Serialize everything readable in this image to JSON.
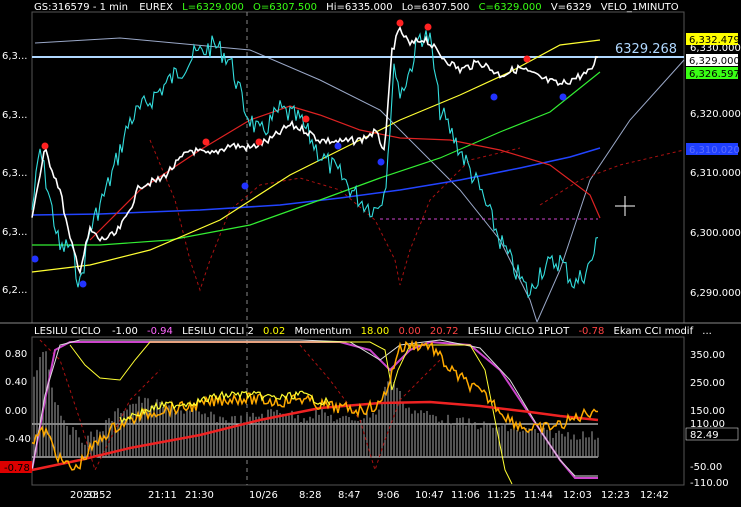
{
  "header": {
    "symbol": "GS:316579 - 1 min",
    "exchange": "EUREX",
    "last": "L=6329.000",
    "open": "O=6307.500",
    "high": "Hi=6335.000",
    "low": "Lo=6307.500",
    "close": "C=6329.000",
    "volume": "V=6329",
    "study": "VELO_1MINUTO"
  },
  "main_panel": {
    "left_axis_labels": [
      "6,3...",
      "6,3...",
      "6,3...",
      "6,3...",
      "6,2..."
    ],
    "right_axis_labels": [
      "6,330.000",
      "6,320.000",
      "6,310.000",
      "6,300.000",
      "6,290.000"
    ],
    "price_tags": [
      {
        "text": "6,332.479",
        "color": "#ffff00"
      },
      {
        "text": "6,329.000",
        "color": "#ffffff"
      },
      {
        "text": "6,326.597",
        "color": "#39ff14"
      },
      {
        "text": "6,310.020",
        "color": "#1f3fff"
      }
    ],
    "hline_label": "6329.268"
  },
  "sub_panel": {
    "legend": [
      {
        "text": "LESILU CICLO",
        "color": "#ffffff"
      },
      {
        "text": "-1.00",
        "color": "#ffffff"
      },
      {
        "text": "-0.94",
        "color": "#ff66ff"
      },
      {
        "text": "LESILU CICLI 2",
        "color": "#ffffff"
      },
      {
        "text": "0.02",
        "color": "#ffff00"
      },
      {
        "text": "Momentum",
        "color": "#ffffff"
      },
      {
        "text": "18.00",
        "color": "#ffff00"
      },
      {
        "text": "0.00",
        "color": "#ff4444"
      },
      {
        "text": "20.72",
        "color": "#ff4444"
      },
      {
        "text": "LESILU CICLO 1PLOT",
        "color": "#ffffff"
      },
      {
        "text": "-0.78",
        "color": "#ff4444"
      },
      {
        "text": "Ekam CCI modif",
        "color": "#ffffff"
      },
      {
        "text": "...",
        "color": "#ffffff"
      }
    ],
    "left_axis_labels": [
      "0.80",
      "0.40",
      "0.00",
      "-0.40",
      "-0.78"
    ],
    "right_axis_labels": [
      "350.00",
      "250.00",
      "150.00",
      "110.00",
      "50.00",
      "-50.00",
      "-110.00"
    ],
    "right_tags": [
      {
        "text": "82.49",
        "color": "#ffffff"
      }
    ],
    "left_tag": "-0.78"
  },
  "time_axis": [
    "20:33",
    "20:52",
    "21:11",
    "21:30",
    "10/26",
    "8:28",
    "8:47",
    "9:06",
    "10:47",
    "11:06",
    "11:25",
    "11:44",
    "12:03",
    "12:23",
    "12:42"
  ],
  "colors": {
    "price": "#ffffff",
    "cyan": "#33dddd",
    "yellow": "#ffff33",
    "green": "#33ee33",
    "blue": "#2244ff",
    "red": "#dd2222",
    "hline": "#b0d8ff",
    "orange": "#ffaa00"
  }
}
